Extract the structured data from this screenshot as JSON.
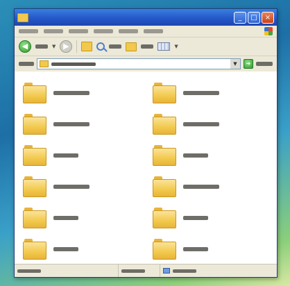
{
  "window": {
    "title": "",
    "controls": {
      "minimize": "_",
      "maximize": "□",
      "close": "×"
    }
  },
  "menu": {
    "items": [
      "",
      "",
      "",
      "",
      "",
      ""
    ]
  },
  "toolbar": {
    "back_label": "",
    "search_label": "",
    "folders_label": ""
  },
  "address": {
    "label": "",
    "path": "",
    "go_label": ""
  },
  "folders": [
    {
      "name": ""
    },
    {
      "name": ""
    },
    {
      "name": ""
    },
    {
      "name": ""
    },
    {
      "name": ""
    },
    {
      "name": ""
    },
    {
      "name": ""
    },
    {
      "name": ""
    },
    {
      "name": ""
    },
    {
      "name": ""
    },
    {
      "name": ""
    },
    {
      "name": ""
    }
  ],
  "status": {
    "objects": "",
    "size": "",
    "location": ""
  },
  "colors": {
    "titlebar": "#2458c9",
    "chrome": "#ece9d8",
    "folder": "#f2c94c",
    "desktop_top": "#2b8fb8",
    "desktop_bottom": "#d7e8a2"
  }
}
